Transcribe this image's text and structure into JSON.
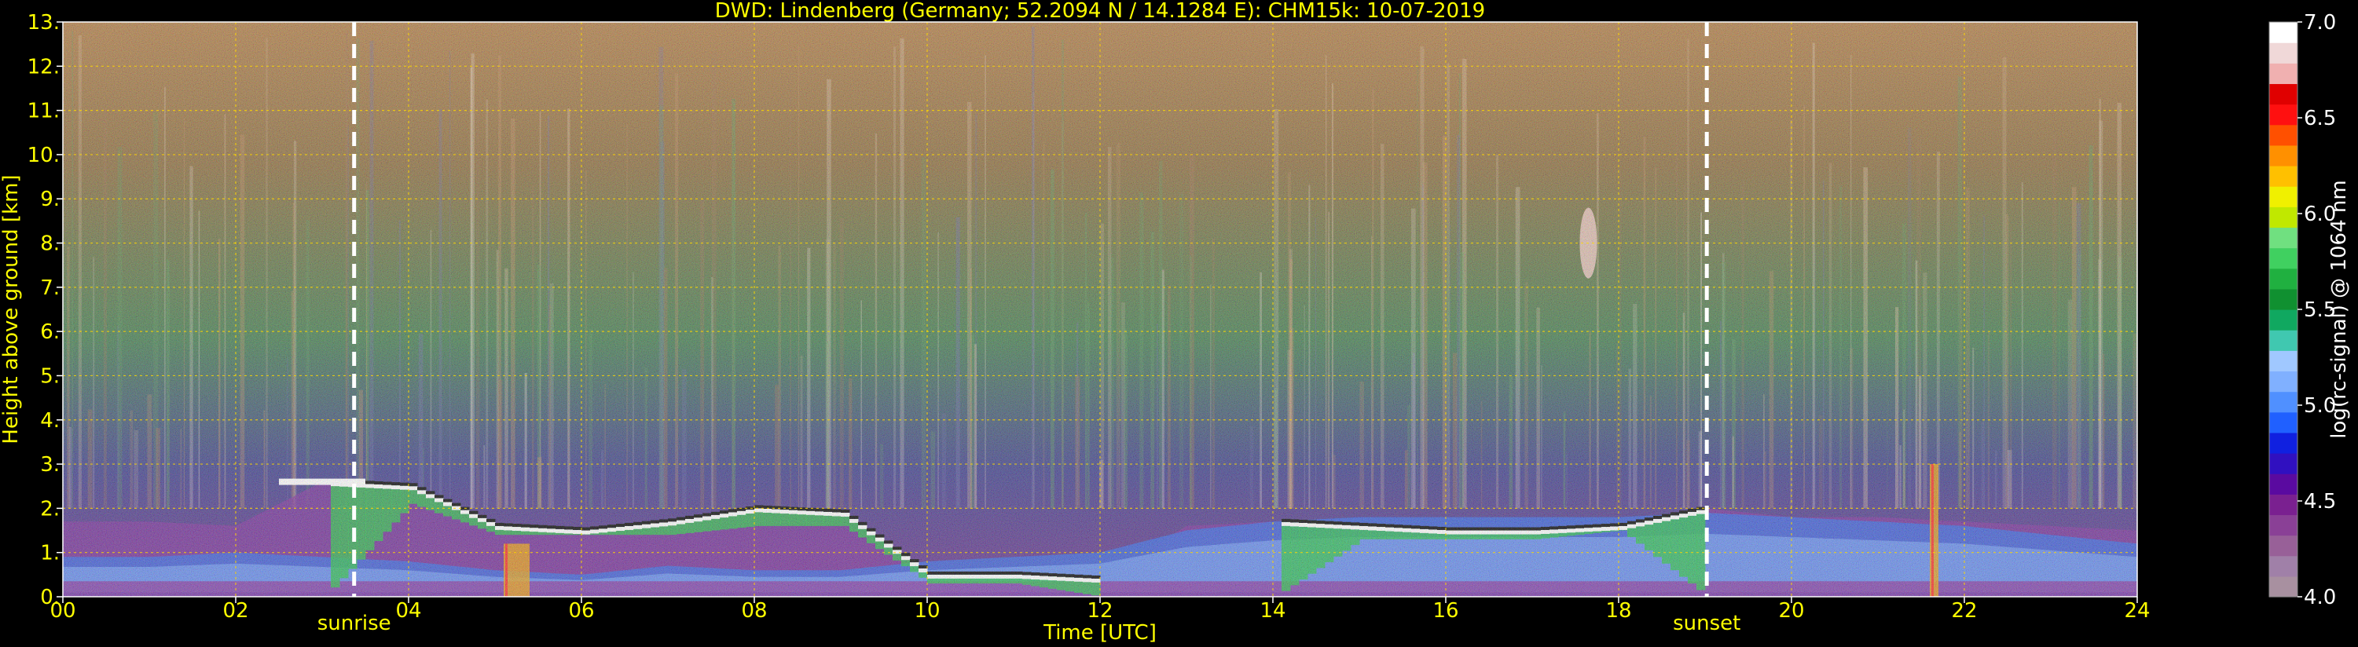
{
  "chart_data": {
    "type": "heatmap",
    "title": "DWD: Lindenberg (Germany; 52.2094 N / 14.1284 E):    CHM15k: 10-07-2019",
    "xlabel": "Time [UTC]",
    "ylabel": "Height above ground [km]",
    "xlim": [
      0,
      24
    ],
    "ylim": [
      0,
      13
    ],
    "x_ticks": [
      0,
      2,
      4,
      6,
      8,
      10,
      12,
      14,
      16,
      18,
      20,
      22,
      24
    ],
    "x_tick_labels": [
      "00",
      "02",
      "04",
      "06",
      "08",
      "10",
      "12",
      "14",
      "16",
      "18",
      "20",
      "22",
      "24"
    ],
    "y_ticks": [
      0,
      1,
      2,
      3,
      4,
      5,
      6,
      7,
      8,
      9,
      10,
      11,
      12,
      13
    ],
    "y_tick_labels": [
      "0.",
      "1.",
      "2.",
      "3.",
      "4.",
      "5.",
      "6.",
      "7.",
      "8.",
      "9.",
      "10.",
      "11.",
      "12.",
      "13."
    ],
    "grid": true,
    "markers": [
      {
        "label": "sunrise",
        "time": 3.37
      },
      {
        "label": "sunset",
        "time": 19.02
      }
    ],
    "colorbar": {
      "label": "log(rc-signal) @ 1064 nm",
      "range": [
        4.0,
        7.0
      ],
      "ticks": [
        4.0,
        4.5,
        5.0,
        5.5,
        6.0,
        6.5,
        7.0
      ],
      "tick_labels": [
        "4.0",
        "4.5",
        "5.0",
        "5.5",
        "6.0",
        "6.5",
        "7.0"
      ],
      "colors": [
        "#a890a0",
        "#a080a8",
        "#986098",
        "#8a4096",
        "#7a2090",
        "#5a0aa0",
        "#3010c0",
        "#1020e0",
        "#2060ff",
        "#5090ff",
        "#80b0ff",
        "#a0c8ff",
        "#40c8b0",
        "#10a860",
        "#109030",
        "#20b040",
        "#40d060",
        "#70e080",
        "#c0e800",
        "#f0f000",
        "#ffc000",
        "#ff9000",
        "#ff5000",
        "#ff1010",
        "#e00000",
        "#f0b0b0",
        "#f0d8d8",
        "#ffffff"
      ]
    },
    "layer_bands": {
      "time": [
        0.0,
        1.0,
        2.0,
        3.0,
        4.0,
        5.0,
        6.0,
        7.0,
        8.0,
        9.0,
        10.0,
        11.0,
        12.0,
        13.0,
        14.0,
        15.0,
        16.0,
        17.0,
        18.0,
        19.0,
        20.0,
        21.0,
        22.0,
        23.0,
        24.0
      ],
      "cloud_top_km": [
        1.7,
        1.7,
        1.6,
        2.6,
        2.5,
        1.6,
        1.5,
        1.7,
        2.0,
        1.9,
        0.5,
        0.5,
        0.4,
        1.6,
        1.7,
        1.6,
        1.5,
        1.5,
        1.6,
        2.0,
        1.8,
        1.8,
        1.7,
        1.6,
        1.5
      ],
      "cloud_base_km": [
        0.0,
        0.0,
        0.0,
        0.0,
        2.1,
        1.4,
        1.4,
        1.4,
        1.6,
        1.6,
        0.3,
        0.3,
        0.0,
        0.0,
        0.0,
        1.3,
        1.3,
        1.3,
        1.5,
        0.0,
        0.0,
        0.0,
        0.0,
        0.0,
        0.0
      ],
      "boundary_layer_km": [
        0.9,
        0.9,
        1.0,
        0.9,
        0.8,
        0.6,
        0.5,
        0.7,
        0.6,
        0.6,
        0.8,
        0.9,
        1.0,
        1.5,
        1.7,
        1.8,
        1.8,
        1.8,
        1.8,
        1.9,
        1.8,
        1.7,
        1.6,
        1.4,
        1.2
      ]
    },
    "features": [
      {
        "type": "elevated_layer",
        "time_start": 2.5,
        "time_end": 3.5,
        "height_km": 2.6
      },
      {
        "type": "plume",
        "time_start": 17.55,
        "time_end": 17.75,
        "height_bottom_km": 7.2,
        "height_top_km": 8.8
      },
      {
        "type": "precipitation_streak",
        "time_start": 21.6,
        "time_end": 21.7,
        "height_bottom_km": 0.0,
        "height_top_km": 3.0
      },
      {
        "type": "precipitation_streak",
        "time_start": 5.1,
        "time_end": 5.4,
        "height_bottom_km": 0.0,
        "height_top_km": 1.2
      }
    ]
  },
  "colors": {
    "text": "#ffff00",
    "background": "#000000",
    "grid": "#ffd800",
    "axis": "#ffffff",
    "sun_marker": "#ffffff",
    "colorbar_label": "#ffffff"
  }
}
